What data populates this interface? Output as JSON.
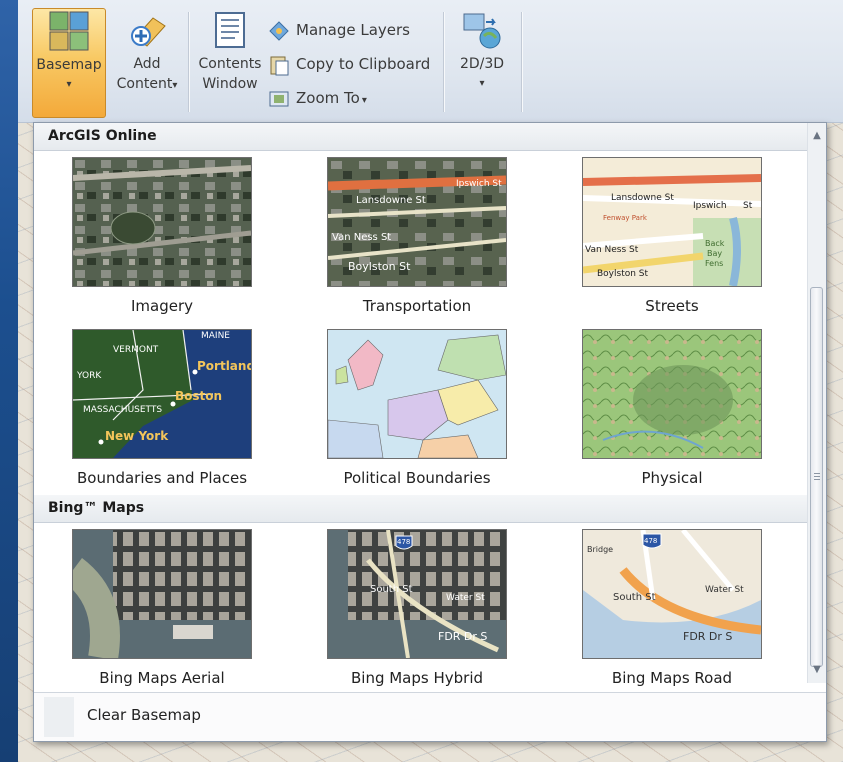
{
  "ribbon": {
    "basemap": {
      "label": "Basemap",
      "arrow": "▾"
    },
    "add_content": {
      "line1": "Add",
      "line2": "Content",
      "arrow": "▾"
    },
    "contents_window": {
      "line1": "Contents",
      "line2": "Window"
    },
    "manage_layers": "Manage Layers",
    "copy_clipboard": "Copy to Clipboard",
    "zoom_to": "Zoom To",
    "zoom_arrow": "▾",
    "view_toggle": {
      "label": "2D/3D",
      "arrow": "▾"
    }
  },
  "dropdown": {
    "sections": [
      {
        "title": "ArcGIS Online",
        "items": [
          {
            "label": "Imagery"
          },
          {
            "label": "Transportation"
          },
          {
            "label": "Streets"
          },
          {
            "label": "Boundaries and Places"
          },
          {
            "label": "Political Boundaries"
          },
          {
            "label": "Physical"
          }
        ]
      },
      {
        "title": "Bing™ Maps",
        "items": [
          {
            "label": "Bing Maps Aerial"
          },
          {
            "label": "Bing Maps Hybrid"
          },
          {
            "label": "Bing Maps Road"
          }
        ]
      }
    ],
    "clear_label": "Clear Basemap"
  },
  "thumb_text": {
    "transport": {
      "road1": "Lansdowne St",
      "road2": "Ipswich St",
      "road3": "Van Ness St",
      "road4": "Boylston St"
    },
    "streets": {
      "road1": "Lansdowne St",
      "road2": "Ipswich",
      "road2b": "St",
      "road3": "Fenway Park",
      "road4": "Van Ness St",
      "road5": "Boylston St",
      "park": "Back",
      "park2": "Bay",
      "park3": "Fens"
    },
    "boundaries": {
      "s1": "VERMONT",
      "s2": "MAINE",
      "s3": "YORK",
      "c1": "Portland",
      "c2": "Boston",
      "s4": "MASSACHUSETTS",
      "c3": "New York"
    },
    "hybrid": {
      "shield": "478",
      "r1": "South St",
      "r2": "FDR Dr S",
      "r3": "Water St"
    },
    "road": {
      "shield": "478",
      "r1": "South St",
      "r2": "FDR Dr S",
      "r3": "Water St",
      "r4": "Bridge"
    }
  },
  "colors": {
    "accent": "#f3a93a",
    "selection_border": "#c88a2a"
  }
}
